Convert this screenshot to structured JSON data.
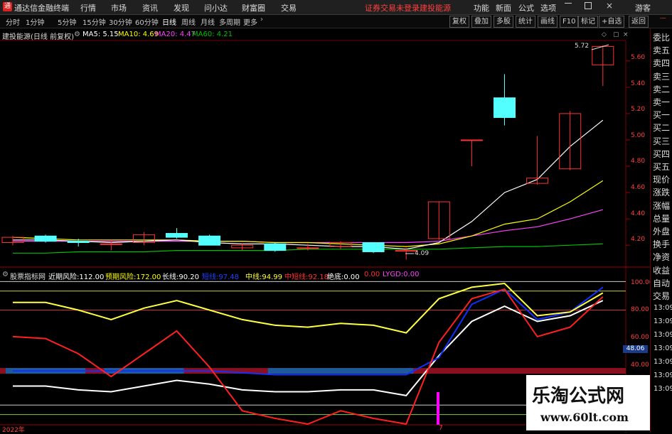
{
  "titlebar": {
    "app_title": "通达信金融终端",
    "menus": [
      "行情",
      "市场",
      "资讯",
      "发现",
      "问小达",
      "财富圈",
      "交易"
    ],
    "notice_login": "证券交易未登录",
    "notice_stock": "建投能源",
    "right_menus": [
      "功能",
      "新面",
      "公式",
      "选项"
    ],
    "guest": "游客"
  },
  "period_bar": {
    "periods": [
      "分时",
      "1分钟",
      "5分钟",
      "15分钟",
      "30分钟",
      "60分钟",
      "日线",
      "周线",
      "月线",
      "多周期",
      "更多"
    ],
    "active_period": "日线",
    "tools": [
      "复权",
      "叠加",
      "多股",
      "统计",
      "画线",
      "F10",
      "标记",
      "+自选",
      "返回"
    ]
  },
  "stock_info": {
    "name": "建投能源(日线 前复权)",
    "ma5_label": "MA5:",
    "ma5_value": "5.15",
    "ma10_label": "MA10:",
    "ma10_value": "4.69",
    "ma20_label": "MA20:",
    "ma20_value": "4.47",
    "ma60_label": "MA60:",
    "ma60_value": "4.21"
  },
  "price_axis": {
    "ticks": [
      "5.60",
      "5.40",
      "5.20",
      "5.00",
      "4.80",
      "4.60",
      "4.40",
      "4.20"
    ],
    "high_label": "5.72",
    "low_label": "4.09"
  },
  "indicator": {
    "name": "股票指标网",
    "items": [
      {
        "label": "近期风险:",
        "value": "112.00",
        "color": "#ffffff"
      },
      {
        "label": "预期风险:",
        "value": "172.00",
        "color": "#ffff00"
      },
      {
        "label": "长线:",
        "value": "90.20",
        "color": "#ffffff"
      },
      {
        "label": "短线:",
        "value": "97.48",
        "color": "#2040ff"
      },
      {
        "label": "中线:",
        "value": "94.99",
        "color": "#ffff40"
      },
      {
        "label": "中短线:",
        "value": "92.18",
        "color": "#ff3030"
      },
      {
        "label": "绝底:",
        "value": "0.00",
        "color": "#ffffff"
      },
      {
        "label": "",
        "value": "0.00",
        "color": "#ff3030"
      },
      {
        "label": "LYGD:",
        "value": "0.00",
        "color": "#ff40ff"
      }
    ],
    "axis_ticks": [
      "100.00",
      "80.00",
      "60.00",
      "40.00"
    ],
    "current_value": "48.06"
  },
  "right_panel": {
    "top_label": "·一",
    "items": [
      "委比",
      "卖五",
      "卖四",
      "卖三",
      "卖二",
      "卖一",
      "买一",
      "买二",
      "买三",
      "买四",
      "买五",
      "现价",
      "涨跌",
      "涨幅",
      "总量",
      "外盘",
      "换手",
      "净资",
      "收益",
      "自动",
      "交易"
    ],
    "times": [
      "13:09",
      "13:09",
      "13:09",
      "13:09",
      "13:09",
      "13:09",
      "13:09"
    ]
  },
  "bottom_axis": {
    "year": "2022年",
    "month": "7"
  },
  "watermark": {
    "title": "乐淘公式网",
    "url": "www.60lt.com"
  },
  "colors": {
    "up": "#ff3232",
    "down": "#54ffff",
    "ma5": "#ffffff",
    "ma10": "#ffff00",
    "ma20": "#ff40ff",
    "ma60": "#00c000"
  },
  "chart_data": {
    "type": "candlestick",
    "price_axis_range": [
      4.05,
      5.75
    ],
    "candles": [
      {
        "o": 4.22,
        "h": 4.27,
        "l": 4.2,
        "c": 4.26
      },
      {
        "o": 4.27,
        "h": 4.28,
        "l": 4.22,
        "c": 4.23
      },
      {
        "o": 4.23,
        "h": 4.25,
        "l": 4.19,
        "c": 4.22
      },
      {
        "o": 4.21,
        "h": 4.24,
        "l": 4.16,
        "c": 4.21
      },
      {
        "o": 4.22,
        "h": 4.3,
        "l": 4.2,
        "c": 4.28
      },
      {
        "o": 4.29,
        "h": 4.33,
        "l": 4.25,
        "c": 4.26
      },
      {
        "o": 4.27,
        "h": 4.28,
        "l": 4.2,
        "c": 4.2
      },
      {
        "o": 4.18,
        "h": 4.21,
        "l": 4.16,
        "c": 4.2
      },
      {
        "o": 4.21,
        "h": 4.22,
        "l": 4.15,
        "c": 4.16
      },
      {
        "o": 4.18,
        "h": 4.21,
        "l": 4.16,
        "c": 4.18
      },
      {
        "o": 4.19,
        "h": 4.23,
        "l": 4.17,
        "c": 4.22
      },
      {
        "o": 4.22,
        "h": 4.22,
        "l": 4.14,
        "c": 4.15
      },
      {
        "o": 4.16,
        "h": 4.18,
        "l": 4.09,
        "c": 4.16
      },
      {
        "o": 4.25,
        "h": 4.53,
        "l": 4.24,
        "c": 4.53
      },
      {
        "o": 5.0,
        "h": 5.0,
        "l": 4.8,
        "c": 5.0
      },
      {
        "o": 5.32,
        "h": 5.5,
        "l": 5.11,
        "c": 5.17
      },
      {
        "o": 4.67,
        "h": 5.03,
        "l": 4.66,
        "c": 4.71
      },
      {
        "o": 4.78,
        "h": 5.22,
        "l": 4.77,
        "c": 5.2
      },
      {
        "o": 5.57,
        "h": 5.72,
        "l": 5.41,
        "c": 5.71
      }
    ],
    "ma5": [
      4.24,
      4.24,
      4.23,
      4.22,
      4.23,
      4.24,
      4.22,
      4.21,
      4.21,
      4.2,
      4.19,
      4.19,
      4.17,
      4.22,
      4.38,
      4.6,
      4.7,
      4.95,
      5.15
    ],
    "ma10": [
      4.26,
      4.25,
      4.24,
      4.24,
      4.24,
      4.24,
      4.23,
      4.23,
      4.22,
      4.22,
      4.21,
      4.2,
      4.19,
      4.21,
      4.27,
      4.36,
      4.4,
      4.53,
      4.69
    ],
    "ma20": [
      4.23,
      4.23,
      4.23,
      4.23,
      4.23,
      4.23,
      4.23,
      4.23,
      4.22,
      4.22,
      4.22,
      4.22,
      4.22,
      4.23,
      4.27,
      4.31,
      4.34,
      4.4,
      4.47
    ],
    "ma60": [
      4.14,
      4.14,
      4.15,
      4.15,
      4.15,
      4.16,
      4.16,
      4.16,
      4.16,
      4.17,
      4.17,
      4.17,
      4.17,
      4.17,
      4.18,
      4.19,
      4.19,
      4.2,
      4.21
    ],
    "indicator_axis_range": [
      25,
      105
    ],
    "ind_yellow": [
      89,
      89,
      85,
      80,
      86,
      90,
      85,
      80,
      77,
      76,
      78,
      77,
      73,
      91,
      97,
      99,
      82,
      84,
      94
    ],
    "ind_red": [
      71,
      70,
      62,
      50,
      62,
      74,
      55,
      32,
      28,
      25,
      32,
      28,
      25,
      68,
      91,
      96,
      71,
      76,
      92
    ],
    "ind_white": [
      45,
      45,
      43,
      42,
      45,
      48,
      46,
      43,
      42,
      42,
      43,
      43,
      40,
      61,
      79,
      87,
      79,
      82,
      90
    ],
    "ind_blue": [
      53,
      53,
      53,
      53,
      53,
      53,
      53,
      52,
      51,
      51,
      51,
      51,
      51,
      60,
      88,
      96,
      80,
      84,
      97
    ]
  }
}
